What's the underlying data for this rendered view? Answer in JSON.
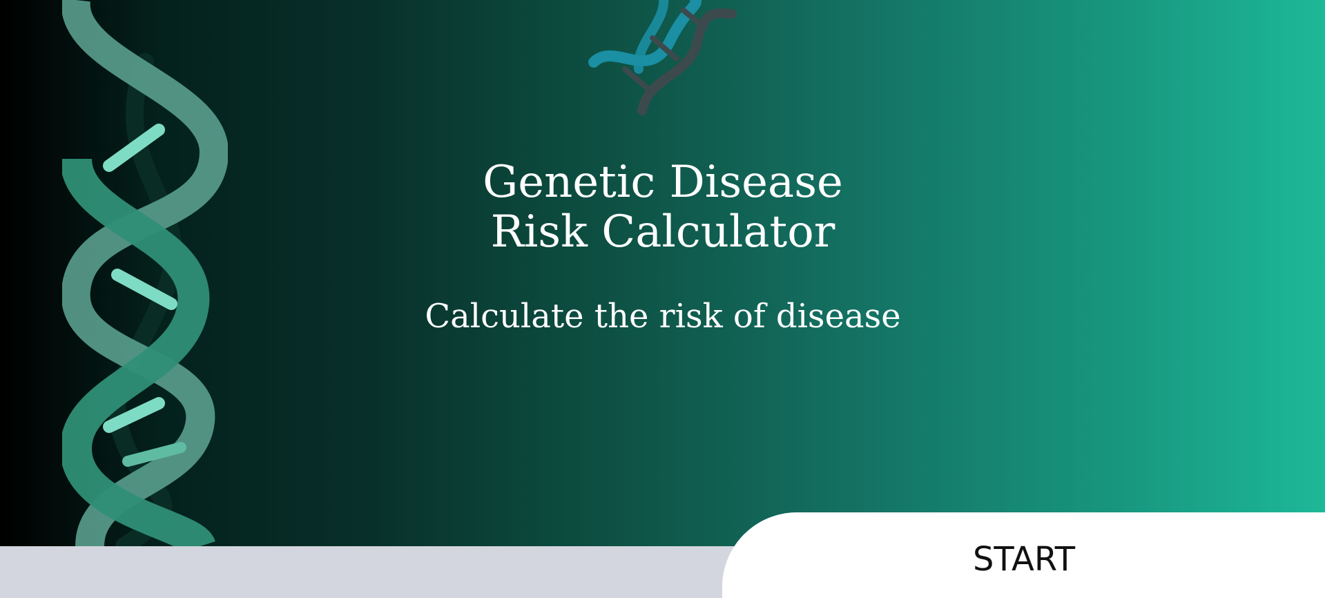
{
  "hero": {
    "title_line1": "Genetic Disease",
    "title_line2": "Risk Calculator",
    "subtitle": "Calculate the risk of disease",
    "decorations": [
      "dna-helix-icon",
      "dna-icon"
    ]
  },
  "start_button": {
    "label": "START"
  },
  "colors": {
    "gradient_start": "#000000",
    "gradient_end": "#1db898",
    "helix_green": "#3a9e87",
    "helix_light": "#7fdcc4",
    "logo_teal": "#1b8fa3",
    "logo_gray": "#3c4a4e",
    "bottom_bar": "#d3d6de",
    "button_bg": "#ffffff"
  }
}
